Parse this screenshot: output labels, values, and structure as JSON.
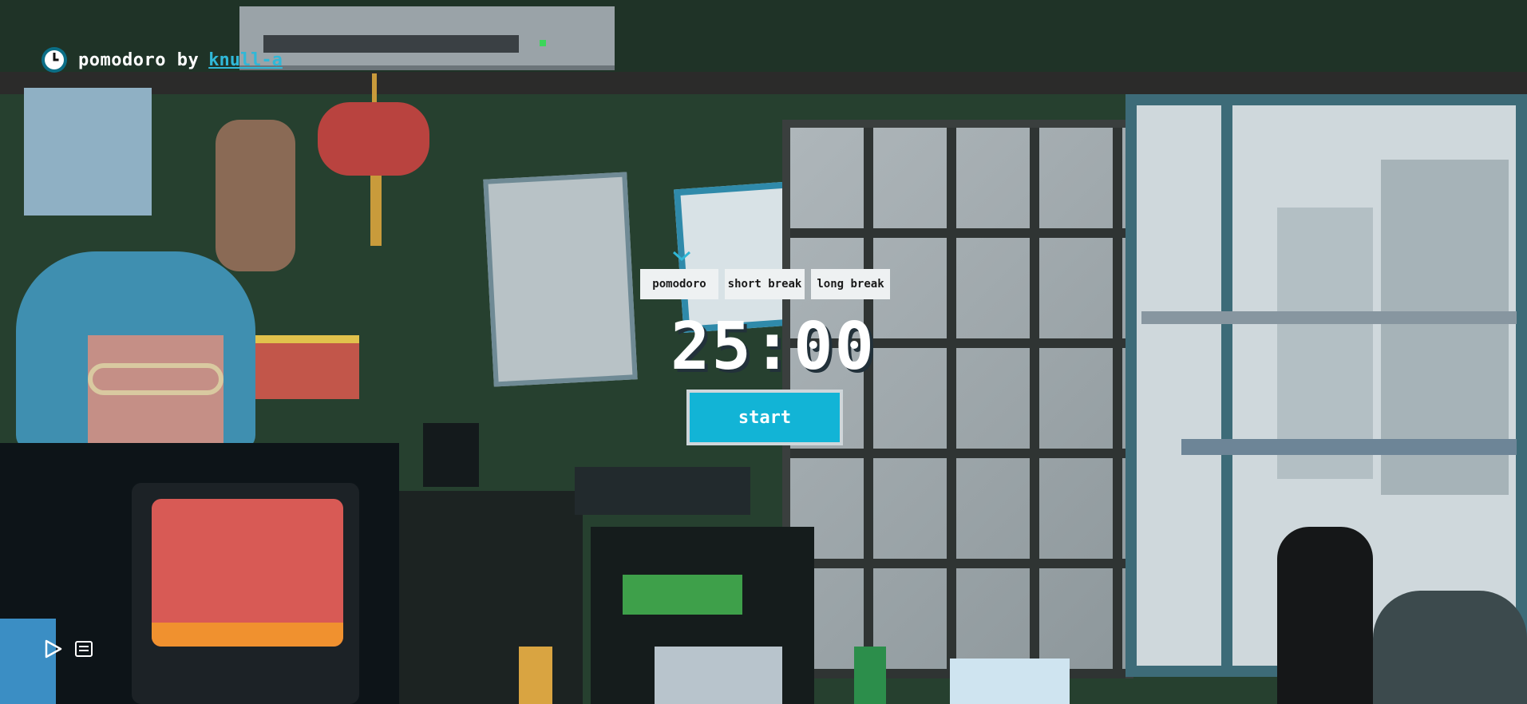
{
  "header": {
    "title": "pomodoro by",
    "author_link": "knull-a",
    "logo_icon": "clock-icon"
  },
  "modes": [
    {
      "label": "pomodoro"
    },
    {
      "label": "short break"
    },
    {
      "label": "long break"
    }
  ],
  "timer": {
    "display": "25:00"
  },
  "actions": {
    "start_label": "start"
  },
  "controls": [
    {
      "icon": "play-icon"
    },
    {
      "icon": "playlist-icon"
    }
  ],
  "colors": {
    "accent": "#12b4d6",
    "link": "#30b8d8",
    "text": "#ffffff"
  }
}
